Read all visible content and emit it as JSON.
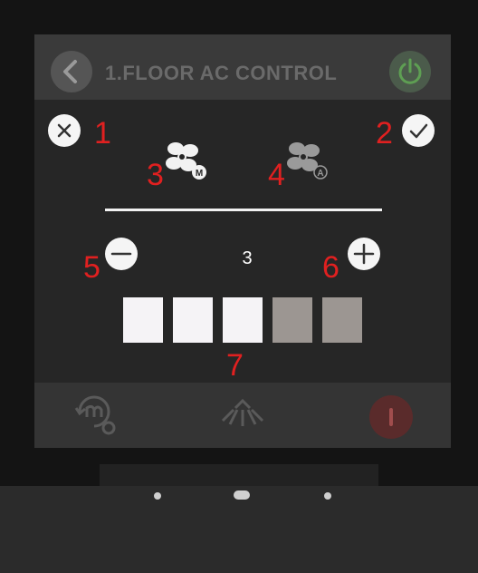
{
  "header": {
    "title": "1.FLOOR AC CONTROL"
  },
  "dialog": {
    "labels": [
      "1",
      "2",
      "3",
      "4",
      "5",
      "6",
      "7"
    ],
    "fan_modes": [
      {
        "name": "manual",
        "badge": "M"
      },
      {
        "name": "auto",
        "badge": "A"
      }
    ],
    "level_value": "3",
    "level_fraction": 0.6
  },
  "icons": {
    "back": "chevron-left-icon",
    "power": "power-icon",
    "cancel": "close-icon",
    "confirm": "check-icon",
    "fan_manual": "fan-manual-icon",
    "fan_auto": "fan-auto-icon",
    "decrease": "minus-icon",
    "increase": "plus-icon",
    "mode_settings": "mode-settings-icon",
    "swing": "air-swing-icon",
    "footer_power": "power-button-icon"
  },
  "colors": {
    "label_red": "#e02020",
    "active_block": "#f5f3f6",
    "inactive_block": "#9c9692"
  }
}
